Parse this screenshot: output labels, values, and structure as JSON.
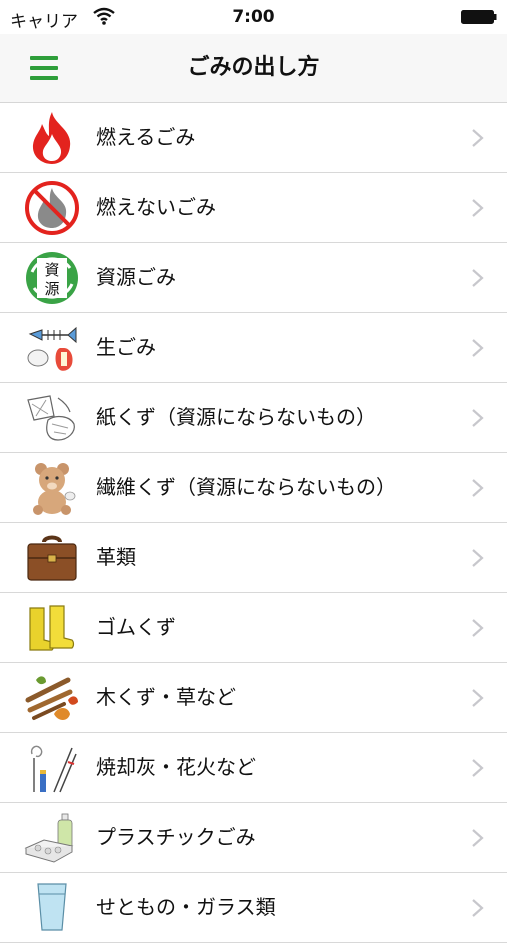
{
  "status": {
    "carrier": "キャリア",
    "time": "7:00"
  },
  "nav": {
    "title": "ごみの出し方",
    "menu_icon": "hamburger-menu-icon"
  },
  "colors": {
    "accent": "#2e9e3a"
  },
  "items": [
    {
      "label": "燃えるごみ",
      "icon": "fire-icon"
    },
    {
      "label": "燃えないごみ",
      "icon": "no-fire-icon"
    },
    {
      "label": "資源ごみ",
      "icon": "recycle-resource-icon"
    },
    {
      "label": "生ごみ",
      "icon": "food-waste-icon"
    },
    {
      "label": "紙くず（資源にならないもの）",
      "icon": "paper-scraps-icon"
    },
    {
      "label": "繊維くず（資源にならないもの）",
      "icon": "teddy-bear-icon"
    },
    {
      "label": "革類",
      "icon": "leather-bag-icon"
    },
    {
      "label": "ゴムくず",
      "icon": "rubber-boots-icon"
    },
    {
      "label": "木くず・草など",
      "icon": "wood-grass-icon"
    },
    {
      "label": "焼却灰・花火など",
      "icon": "ash-fireworks-icon"
    },
    {
      "label": "プラスチックごみ",
      "icon": "plastic-icon"
    },
    {
      "label": "せともの・ガラス類",
      "icon": "glass-icon"
    }
  ]
}
